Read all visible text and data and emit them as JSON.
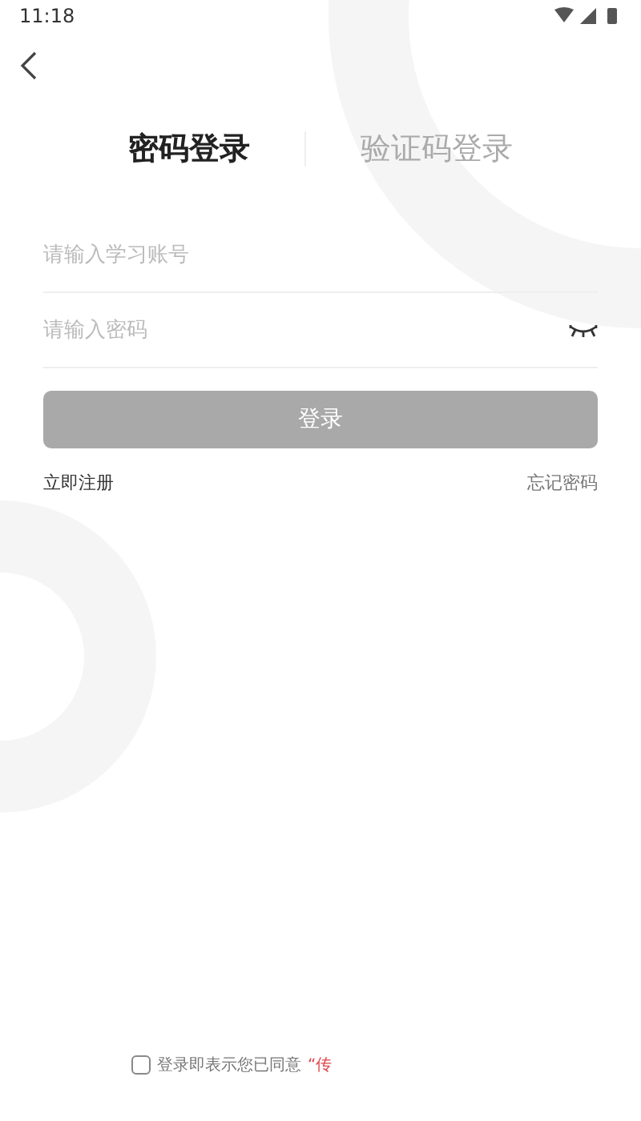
{
  "status_bar": {
    "time": "11:18"
  },
  "tabs": [
    {
      "label": "密码登录",
      "selected": true
    },
    {
      "label": "验证码登录",
      "selected": false
    }
  ],
  "fields": [
    {
      "placeholder": "请输入学习账号",
      "kind": "text"
    },
    {
      "placeholder": "请输入密码",
      "kind": "password"
    }
  ],
  "login_button": {
    "label": "登录",
    "disabled": true
  },
  "links": {
    "register": "立即注册",
    "forgot": "忘记密码"
  },
  "agreement": {
    "checked": false,
    "text": "登录即表示您已同意",
    "link": "“传"
  }
}
